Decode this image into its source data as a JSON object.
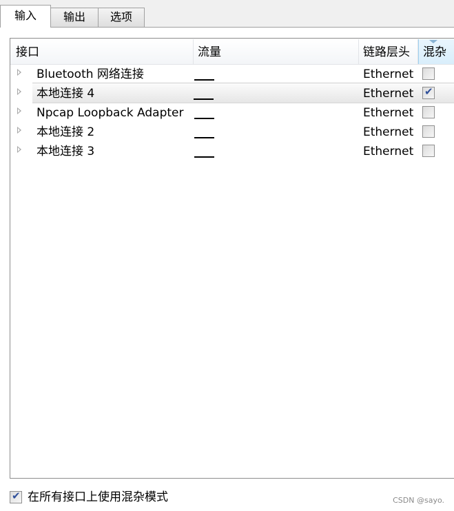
{
  "tabs": [
    {
      "label": "输入",
      "active": true
    },
    {
      "label": "输出",
      "active": false
    },
    {
      "label": "选项",
      "active": false
    }
  ],
  "table": {
    "columns": [
      "接口",
      "流量",
      "链路层头",
      "混杂"
    ],
    "sorted_column": "混杂",
    "rows": [
      {
        "name": "Bluetooth 网络连接",
        "link_layer": "Ethernet",
        "promiscuous": false,
        "selected": false
      },
      {
        "name": "本地连接 4",
        "link_layer": "Ethernet",
        "promiscuous": true,
        "selected": true
      },
      {
        "name": "Npcap Loopback Adapter",
        "link_layer": "Ethernet",
        "promiscuous": false,
        "selected": false
      },
      {
        "name": "本地连接 2",
        "link_layer": "Ethernet",
        "promiscuous": false,
        "selected": false
      },
      {
        "name": "本地连接 3",
        "link_layer": "Ethernet",
        "promiscuous": false,
        "selected": false
      }
    ]
  },
  "footer": {
    "promisc_all_label": "在所有接口上使用混杂模式",
    "promisc_all_checked": true
  },
  "watermark": "CSDN @sayo."
}
